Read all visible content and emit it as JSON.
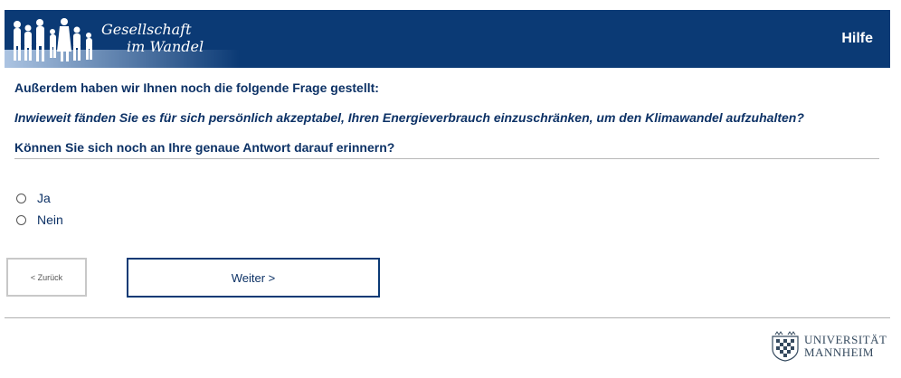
{
  "header": {
    "brand_line1": "Gesellschaft",
    "brand_line2": "im Wandel",
    "help_label": "Hilfe",
    "background_color": "#0b3a75"
  },
  "survey": {
    "intro": "Außerdem haben wir Ihnen noch die folgende Frage gestellt:",
    "question": "Inwieweit fänden Sie es für sich persönlich akzeptabel, Ihren Energieverbrauch einzuschränken, um den Klimawandel aufzuhalten?",
    "subquestion": "Können Sie sich noch an Ihre genaue Antwort darauf erinnern?",
    "options": [
      {
        "label": "Ja",
        "selected": false
      },
      {
        "label": "Nein",
        "selected": false
      }
    ]
  },
  "nav": {
    "back_label": "< Zurück",
    "next_label": "Weiter >"
  },
  "footer": {
    "logo_line1": "UNIVERSITÄT",
    "logo_line2": "MANNHEIM",
    "logo_icon": "university-crest-icon"
  }
}
